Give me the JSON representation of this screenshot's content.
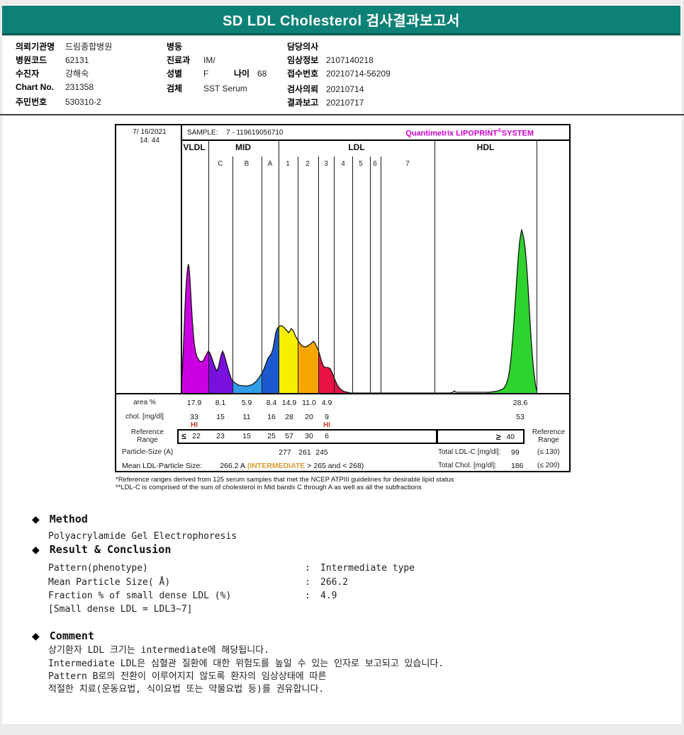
{
  "page": {
    "title": "SD LDL Cholesterol 검사결과보고서"
  },
  "colors": {
    "header_teal": "#0e8176",
    "brand_magenta": "#cc00cc",
    "hi_flag_red": "#c9402e",
    "intermediate_orange": "#dd9a33"
  },
  "patient": {
    "org_label": "의뢰기관명",
    "org": "드림종합병원",
    "hosp_code_label": "병원코드",
    "hosp_code": "62131",
    "patient_label": "수진자",
    "patient_name": "강해숙",
    "chart_no_label": "Chart No.",
    "chart_no": "231358",
    "resident_label": "주민번호",
    "resident_no": "530310-2",
    "ward_label": "병동",
    "ward": "",
    "dept_label": "진료과",
    "dept": "IM/",
    "sex_label": "성별",
    "sex": "F",
    "age_label": "나이",
    "age": "68",
    "specimen_label": "검체",
    "specimen": "SST Serum",
    "doctor_label": "담당의사",
    "doctor": "",
    "clinical_label": "임상정보",
    "clinical": "2107140218",
    "receipt_label": "접수번호",
    "receipt": "20210714-56209",
    "request_label": "검사의뢰",
    "request": "20210714",
    "report_label": "결과보고",
    "report": "20210717"
  },
  "chart": {
    "date_line1": "7/ 16/2021",
    "date_line2": "14: 44",
    "sample_label": "SAMPLE:",
    "sample_value": "7 - 119619056710",
    "brand_left": "Quantimetrix LIPOPRINT",
    "brand_reg": "®",
    "brand_right": "SYSTEM",
    "row_labels": {
      "area": "area %",
      "chol": "chol. [mg/dl]",
      "ref1": "Reference",
      "ref2": "Range",
      "particle": "Particle-Size (A)",
      "mean": "Mean LDL-Particle Size:"
    },
    "mean_value": "266.2 A",
    "mean_flag": "(INTERMEDIATE",
    "mean_range": "> 265 and < 268)",
    "totals": {
      "ldl_label": "Total LDL-C [mg/dl]:",
      "ldl": "99",
      "ldl_ref": "(≤ 130)",
      "chol_label": "Total Chol. [mg/dl]:",
      "chol": "186",
      "chol_ref": "(≤ 200)"
    }
  },
  "chart_data": {
    "type": "area",
    "title": "Quantimetrix LIPOPRINT SYSTEM lipoprotein subfraction profile",
    "sample": "7 - 119619056710",
    "datetime": "7/ 16/2021 14: 44",
    "x_groups": [
      "VLDL",
      "MID",
      "LDL",
      "HDL"
    ],
    "subbands": [
      "C",
      "B",
      "A",
      "1",
      "2",
      "3",
      "4",
      "5",
      "6",
      "7"
    ],
    "bands": [
      {
        "name": "VLDL",
        "area_pct": "17.9",
        "chol_mg_dl": "33",
        "flag": "HI",
        "ref_op": "≤",
        "ref": "22",
        "color": "#cb00e0"
      },
      {
        "name": "MID-C",
        "area_pct": "8.1",
        "chol_mg_dl": "15",
        "flag": "",
        "ref_op": "",
        "ref": "23",
        "color": "#7a10dd"
      },
      {
        "name": "MID-B",
        "area_pct": "5.9",
        "chol_mg_dl": "11",
        "flag": "",
        "ref_op": "",
        "ref": "15",
        "color": "#2f9ce8"
      },
      {
        "name": "MID-A",
        "area_pct": "8.4",
        "chol_mg_dl": "16",
        "flag": "",
        "ref_op": "",
        "ref": "25",
        "color": "#1b59cf"
      },
      {
        "name": "LDL-1",
        "area_pct": "14.9",
        "chol_mg_dl": "28",
        "flag": "",
        "ref_op": "",
        "ref": "57",
        "color": "#f6ef00",
        "particle_size_A": "277"
      },
      {
        "name": "LDL-2",
        "area_pct": "11.0",
        "chol_mg_dl": "20",
        "flag": "",
        "ref_op": "",
        "ref": "30",
        "color": "#f7a600",
        "particle_size_A": "261"
      },
      {
        "name": "LDL-3",
        "area_pct": "4.9",
        "chol_mg_dl": "9",
        "flag": "HI",
        "ref_op": "",
        "ref": "6",
        "color": "#e81243",
        "particle_size_A": "245"
      },
      {
        "name": "HDL",
        "area_pct": "28.6",
        "chol_mg_dl": "53",
        "flag": "",
        "ref_op": "≥",
        "ref": "40",
        "color": "#2fd32f"
      }
    ],
    "mean_ldl_particle_size": "266.2 A",
    "mean_classification": "INTERMEDIATE (> 265 and < 268)",
    "total_ldl_c_mg_dl": "99",
    "total_ldl_c_ref": "≤ 130",
    "total_chol_mg_dl": "186",
    "total_chol_ref": "≤ 200"
  },
  "footnotes": [
    "*Reference ranges derived from 125 serum samples that met the NCEP ATPIII guidelines for desirable lipid status",
    "**LDL-C is comprised of the sum of cholesterol in Mid bands C through A as well as all the subfractions"
  ],
  "method": {
    "bullet": "◆",
    "heading": "Method",
    "body": "Polyacrylamide Gel Electrophoresis"
  },
  "result": {
    "bullet": "◆",
    "heading": "Result & Conclusion",
    "colon": ":",
    "rows": [
      {
        "label": "Pattern(phenotype)",
        "value": "Intermediate type"
      },
      {
        "label": "Mean Particle Size( Å)",
        "value": "266.2"
      },
      {
        "label": "Fraction % of small dense LDL (%)",
        "value": "4.9"
      }
    ],
    "note": "[Small dense LDL = LDL3~7]"
  },
  "comment": {
    "bullet": "◆",
    "heading": "Comment",
    "lines": [
      "상기환자 LDL 크기는 intermediate에 해당됩니다.",
      "Intermediate LDL은 심혈관 질환에 대한 위험도를 높일 수 있는 인자로 보고되고 있습니다.",
      "Pattern B로의 전환이 이루어지지 않도록 환자의 임상상태에 따른",
      "적절한 치료(운동요법, 식이요법 또는 약물요법 등)를 권유합니다."
    ]
  }
}
